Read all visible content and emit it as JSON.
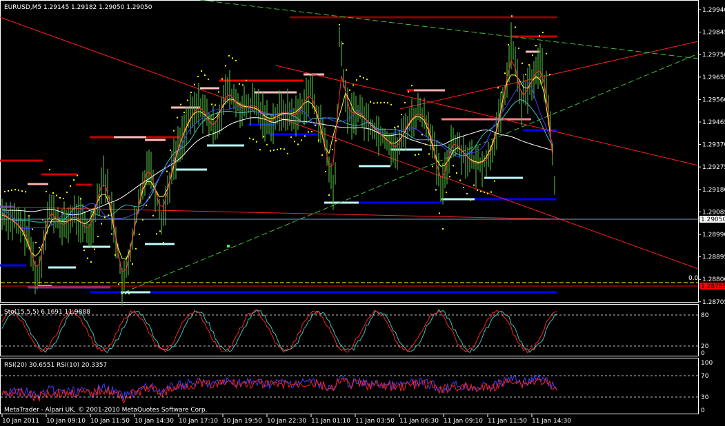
{
  "main_panel": {
    "header": "EURUSD,M5  1.29145 1.29182 1.29050 1.29050",
    "price_ticks": [
      "1.29940",
      "1.29845",
      "1.29750",
      "1.29655",
      "1.29560",
      "1.29465",
      "1.29370",
      "1.29275",
      "1.29180",
      "1.29085",
      "1.28990",
      "1.28895",
      "1.28800",
      "1.28705"
    ],
    "current_price": "1.29050",
    "red_level_price": "1.28785",
    "fib_label": "0.0"
  },
  "stoch_panel": {
    "header": "Sto(15,5,5) 6.1691 11.9888",
    "levels": [
      "80",
      "20",
      "0"
    ]
  },
  "rsi_panel": {
    "header": "RSI(20) 30.6551  RSI(10) 20.3357",
    "levels": [
      "100",
      "70",
      "30",
      "0"
    ]
  },
  "copyright": "MetaTrader - Alpari UK, © 2001-2010 MetaQuotes Software Corp.",
  "time_labels": [
    "10 Jan 2011",
    "10 Jan 09:10",
    "10 Jan 11:50",
    "10 Jan 14:30",
    "10 Jan 17:10",
    "10 Jan 19:50",
    "10 Jan 22:30",
    "11 Jan 01:10",
    "11 Jan 03:50",
    "11 Jan 06:30",
    "11 Jan 09:10",
    "11 Jan 11:50",
    "11 Jan 14:30"
  ],
  "colors": {
    "candles": "#4caf3c",
    "support_line": "#0000ff",
    "resistance_line": "#cc0000",
    "trend_red": "#ff2020",
    "trend_green": "#40c040",
    "sar_dots": "#ffff00",
    "ma_white": "#ffffff",
    "ma_cyan": "#40c0c0",
    "ma_blue": "#4040ff",
    "stoch_main": "#40c0c0",
    "stoch_signal": "#ff2020",
    "rsi_main": "#4040ff",
    "rsi_signal": "#ff2020"
  }
}
